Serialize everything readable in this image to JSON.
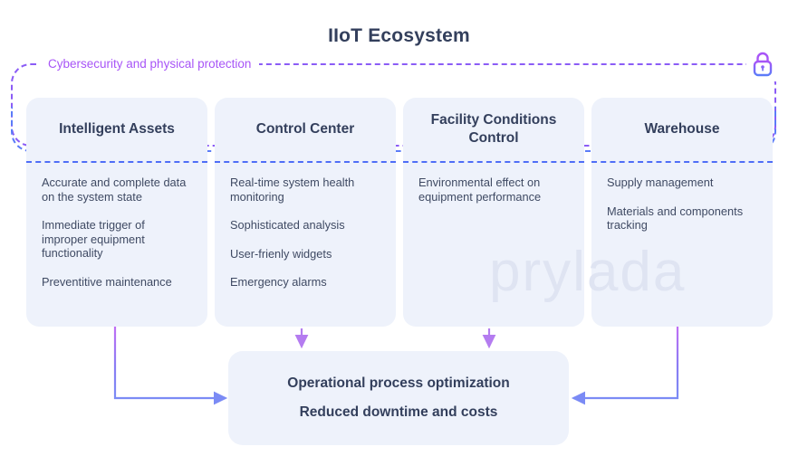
{
  "page": {
    "title": "IIoT Ecosystem",
    "background_color": "#ffffff",
    "title_color": "#333f5c",
    "card_color": "#eef2fb",
    "accent_purple": "#a855f7",
    "accent_blue": "#4f6ef7",
    "watermark": "prylada"
  },
  "security": {
    "label": "Cybersecurity and physical protection",
    "icon": "lock-icon",
    "border_style": "dashed",
    "color_start": "#a855f7",
    "color_end": "#5b7cf8"
  },
  "columns": [
    {
      "title": "Intelligent Assets",
      "items": [
        "Accurate and complete data on the system state",
        "Immediate trigger of improper equipment functionality",
        "Preventitive maintenance"
      ]
    },
    {
      "title": "Control Center",
      "items": [
        "Real-time  system health monitoring",
        "Sophisticated analysis",
        "User-frienly widgets",
        "Emergency alarms"
      ]
    },
    {
      "title": "Facility Conditions Control",
      "items": [
        "Environmental effect on equipment performance"
      ]
    },
    {
      "title": "Warehouse",
      "items": [
        "Supply management",
        "Materials and components tracking"
      ]
    }
  ],
  "result": {
    "line1": "Operational process optimization",
    "line2": "Reduced downtime and costs"
  },
  "arrows": [
    {
      "name": "arrow-intelligent-assets-to-result",
      "color": "#7b7cf0"
    },
    {
      "name": "arrow-control-center-to-result",
      "color": "#b47cf0"
    },
    {
      "name": "arrow-facility-conditions-to-result",
      "color": "#b47cf0"
    },
    {
      "name": "arrow-warehouse-to-result",
      "color": "#7b7cf0"
    }
  ]
}
